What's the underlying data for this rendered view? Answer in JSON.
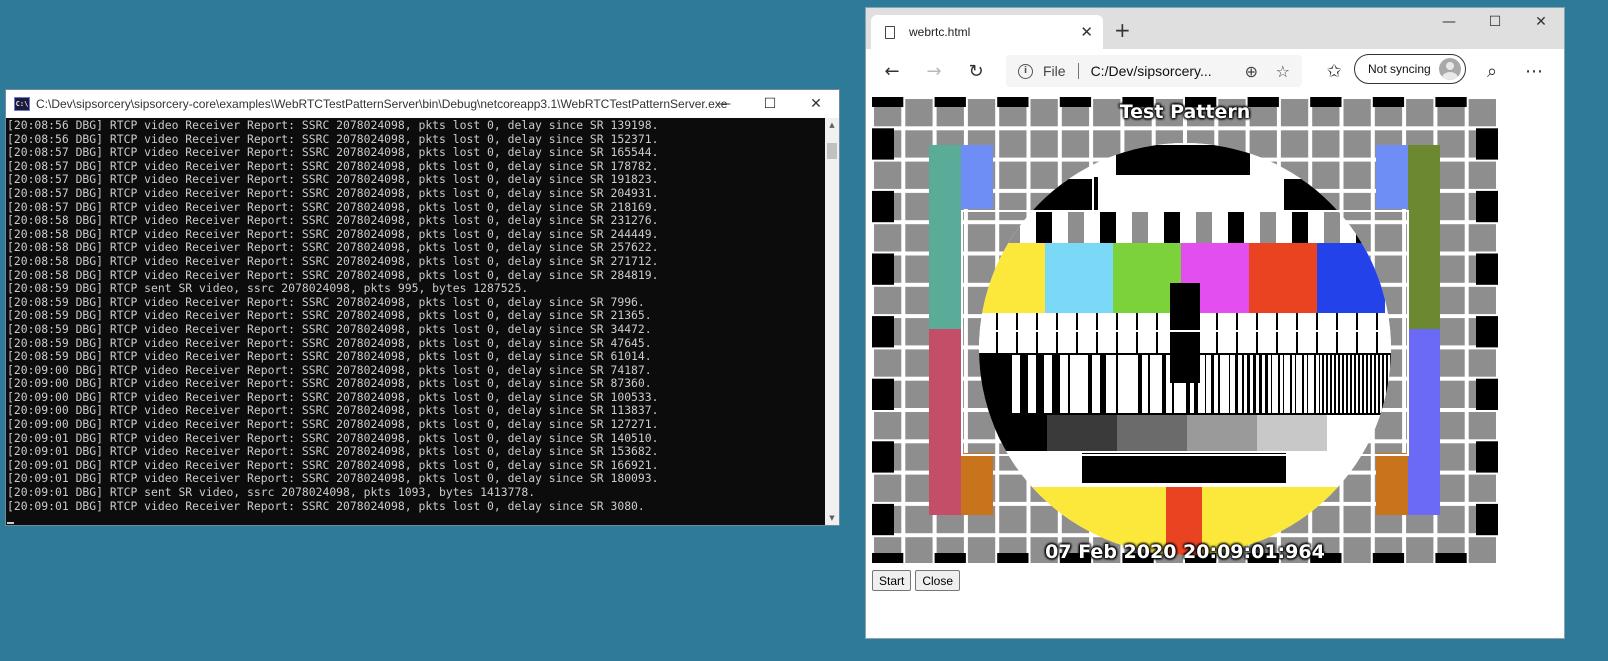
{
  "console": {
    "title": "C:\\Dev\\sipsorcery\\sipsorcery-core\\examples\\WebRTCTestPatternServer\\bin\\Debug\\netcoreapp3.1\\WebRTCTestPatternServer.exe",
    "icon_text": "C:\\",
    "minimize_icon": "—",
    "maximize_icon": "☐",
    "close_icon": "✕",
    "lines": [
      "[20:08:56 DBG] RTCP video Receiver Report: SSRC 2078024098, pkts lost 0, delay since SR 139198.",
      "[20:08:56 DBG] RTCP video Receiver Report: SSRC 2078024098, pkts lost 0, delay since SR 152371.",
      "[20:08:57 DBG] RTCP video Receiver Report: SSRC 2078024098, pkts lost 0, delay since SR 165544.",
      "[20:08:57 DBG] RTCP video Receiver Report: SSRC 2078024098, pkts lost 0, delay since SR 178782.",
      "[20:08:57 DBG] RTCP video Receiver Report: SSRC 2078024098, pkts lost 0, delay since SR 191823.",
      "[20:08:57 DBG] RTCP video Receiver Report: SSRC 2078024098, pkts lost 0, delay since SR 204931.",
      "[20:08:57 DBG] RTCP video Receiver Report: SSRC 2078024098, pkts lost 0, delay since SR 218169.",
      "[20:08:58 DBG] RTCP video Receiver Report: SSRC 2078024098, pkts lost 0, delay since SR 231276.",
      "[20:08:58 DBG] RTCP video Receiver Report: SSRC 2078024098, pkts lost 0, delay since SR 244449.",
      "[20:08:58 DBG] RTCP video Receiver Report: SSRC 2078024098, pkts lost 0, delay since SR 257622.",
      "[20:08:58 DBG] RTCP video Receiver Report: SSRC 2078024098, pkts lost 0, delay since SR 271712.",
      "[20:08:58 DBG] RTCP video Receiver Report: SSRC 2078024098, pkts lost 0, delay since SR 284819.",
      "[20:08:59 DBG] RTCP sent SR video, ssrc 2078024098, pkts 995, bytes 1287525.",
      "[20:08:59 DBG] RTCP video Receiver Report: SSRC 2078024098, pkts lost 0, delay since SR 7996.",
      "[20:08:59 DBG] RTCP video Receiver Report: SSRC 2078024098, pkts lost 0, delay since SR 21365.",
      "[20:08:59 DBG] RTCP video Receiver Report: SSRC 2078024098, pkts lost 0, delay since SR 34472.",
      "[20:08:59 DBG] RTCP video Receiver Report: SSRC 2078024098, pkts lost 0, delay since SR 47645.",
      "[20:08:59 DBG] RTCP video Receiver Report: SSRC 2078024098, pkts lost 0, delay since SR 61014.",
      "[20:09:00 DBG] RTCP video Receiver Report: SSRC 2078024098, pkts lost 0, delay since SR 74187.",
      "[20:09:00 DBG] RTCP video Receiver Report: SSRC 2078024098, pkts lost 0, delay since SR 87360.",
      "[20:09:00 DBG] RTCP video Receiver Report: SSRC 2078024098, pkts lost 0, delay since SR 100533.",
      "[20:09:00 DBG] RTCP video Receiver Report: SSRC 2078024098, pkts lost 0, delay since SR 113837.",
      "[20:09:00 DBG] RTCP video Receiver Report: SSRC 2078024098, pkts lost 0, delay since SR 127271.",
      "[20:09:01 DBG] RTCP video Receiver Report: SSRC 2078024098, pkts lost 0, delay since SR 140510.",
      "[20:09:01 DBG] RTCP video Receiver Report: SSRC 2078024098, pkts lost 0, delay since SR 153682.",
      "[20:09:01 DBG] RTCP video Receiver Report: SSRC 2078024098, pkts lost 0, delay since SR 166921.",
      "[20:09:01 DBG] RTCP video Receiver Report: SSRC 2078024098, pkts lost 0, delay since SR 180093.",
      "[20:09:01 DBG] RTCP sent SR video, ssrc 2078024098, pkts 1093, bytes 1413778.",
      "[20:09:01 DBG] RTCP video Receiver Report: SSRC 2078024098, pkts lost 0, delay since SR 3080."
    ]
  },
  "browser": {
    "tab_title": "webrtc.html",
    "tab_close_icon": "✕",
    "new_tab_icon": "+",
    "minimize_icon": "—",
    "maximize_icon": "☐",
    "close_icon": "✕",
    "back_icon": "←",
    "forward_icon": "→",
    "refresh_icon": "↻",
    "info_icon": "i",
    "scheme": "File",
    "url": "C:/Dev/sipsorcery...",
    "zoom_icon": "⊕",
    "favorite_icon": "☆",
    "favorites_icon": "✩",
    "sync_label": "Not syncing",
    "read_aloud_icon": "⌕",
    "more_icon": "⋯",
    "video_title": "Test Pattern",
    "video_timestamp": "07 Feb 2020 20:09:01:964",
    "start_label": "Start",
    "close_label": "Close"
  },
  "colors": {
    "desktop": "#2d7b98",
    "console_bg": "#0c0c0c",
    "console_text": "#cccccc",
    "color_bars": [
      "#fbe83a",
      "#7bd9f8",
      "#7cd23a",
      "#e24ef0",
      "#ea4322",
      "#2342ea"
    ]
  }
}
